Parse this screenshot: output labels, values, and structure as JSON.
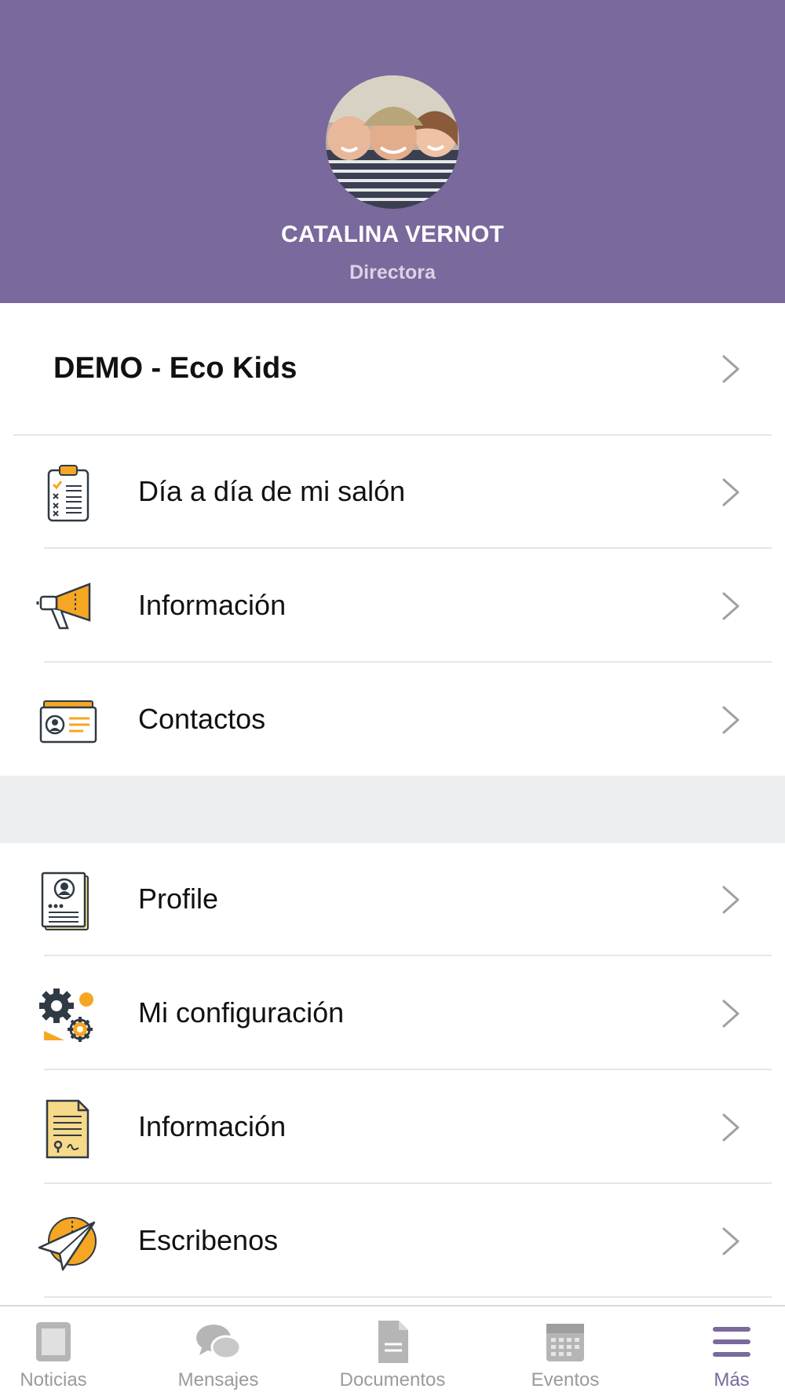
{
  "profile": {
    "name": "CATALINA VERNOT",
    "role": "Directora"
  },
  "school": {
    "name": "DEMO - Eco Kids"
  },
  "menu_primary": [
    {
      "label": "Día a día de mi salón",
      "icon": "clipboard-checklist-icon"
    },
    {
      "label": "Información",
      "icon": "megaphone-icon"
    },
    {
      "label": "Contactos",
      "icon": "contact-card-icon"
    }
  ],
  "menu_secondary": [
    {
      "label": "Profile",
      "icon": "profile-document-icon"
    },
    {
      "label": "Mi configuración",
      "icon": "gears-icon"
    },
    {
      "label": "Información",
      "icon": "certificate-document-icon"
    },
    {
      "label": "Escribenos",
      "icon": "paper-plane-icon"
    }
  ],
  "tabbar": {
    "tabs": [
      {
        "label": "Noticias",
        "icon": "newspaper-icon",
        "active": false
      },
      {
        "label": "Mensajes",
        "icon": "chat-bubbles-icon",
        "active": false
      },
      {
        "label": "Documentos",
        "icon": "document-icon",
        "active": false
      },
      {
        "label": "Eventos",
        "icon": "calendar-icon",
        "active": false
      },
      {
        "label": "Más",
        "icon": "hamburger-menu-icon",
        "active": true
      }
    ]
  },
  "colors": {
    "header": "#7a699c",
    "accent_orange": "#f5a623",
    "icon_dark": "#2f3a45",
    "tab_inactive": "#b5b5b5",
    "tab_active": "#7a699c"
  }
}
